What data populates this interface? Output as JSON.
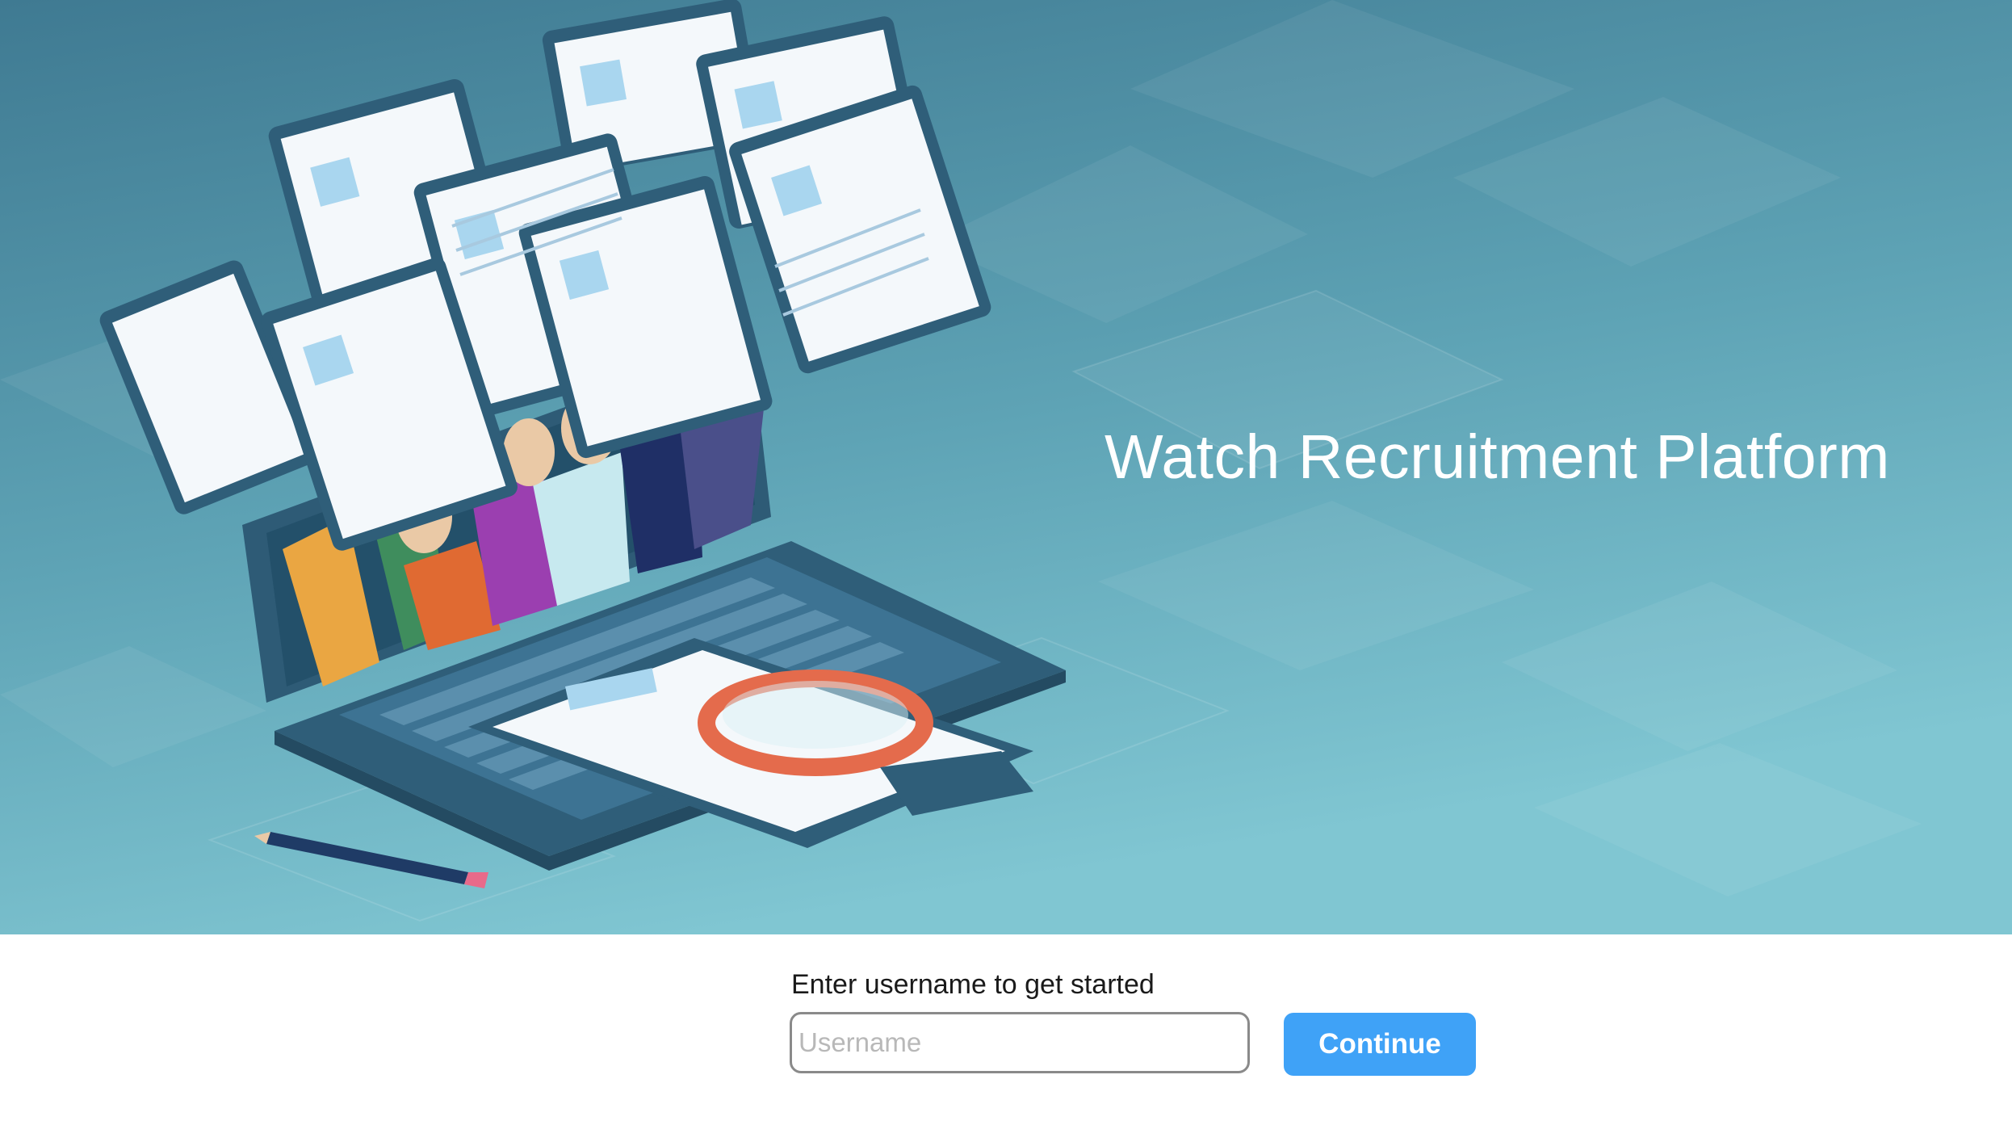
{
  "hero": {
    "title": "Watch Recruitment Platform",
    "illustration": "laptop-with-resume-clipboards-and-magnifier",
    "gradient_top": "#3f7a92",
    "gradient_bottom": "#80c6d2"
  },
  "login": {
    "prompt": "Enter username to get started",
    "username_placeholder": "Username",
    "username_value": "",
    "continue_label": "Continue",
    "accent": "#3fa2f7"
  }
}
